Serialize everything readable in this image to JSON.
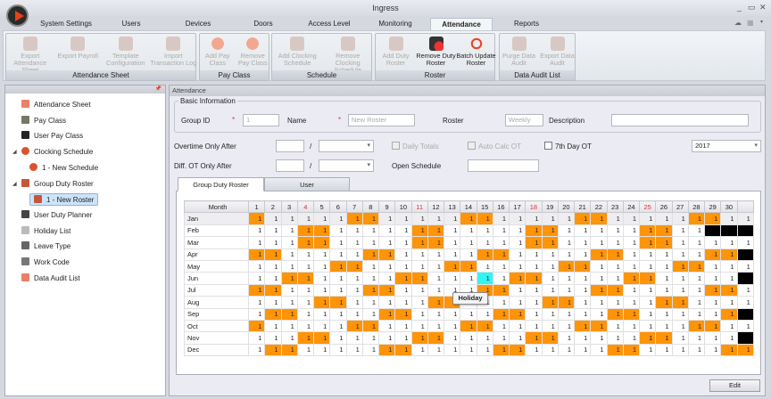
{
  "window": {
    "title": "Ingress",
    "controls": [
      "_",
      "▭",
      "✕"
    ]
  },
  "menu_tabs": [
    "System Settings",
    "Users",
    "Devices",
    "Doors",
    "Access Level",
    "Monitoring",
    "Attendance",
    "Reports"
  ],
  "active_tab": "Attendance",
  "ribbon": {
    "groups": [
      {
        "label": "Attendance Sheet",
        "buttons": [
          {
            "label": "Export Attendance Sheet",
            "enabled": false
          },
          {
            "label": "Export Payroll",
            "enabled": false
          },
          {
            "label": "Template Configuration",
            "enabled": false
          },
          {
            "label": "Import Transaction Log",
            "enabled": false
          }
        ]
      },
      {
        "label": "Pay Class",
        "buttons": [
          {
            "label": "Add Pay Class",
            "enabled": false
          },
          {
            "label": "Remove Pay Class",
            "enabled": false
          }
        ]
      },
      {
        "label": "Schedule",
        "buttons": [
          {
            "label": "Add Clocking Schedule",
            "enabled": false
          },
          {
            "label": "Remove Clocking Schedule",
            "enabled": false
          }
        ]
      },
      {
        "label": "Roster",
        "buttons": [
          {
            "label": "Add Duty Roster",
            "enabled": false
          },
          {
            "label": "Remove Duty Roster",
            "enabled": true
          },
          {
            "label": "Batch Update Roster",
            "enabled": true
          }
        ]
      },
      {
        "label": "Data Audit List",
        "buttons": [
          {
            "label": "Purge Data Audit",
            "enabled": false
          },
          {
            "label": "Export Data Audit",
            "enabled": false
          }
        ]
      }
    ]
  },
  "sidebar": {
    "items": [
      {
        "label": "Attendance Sheet",
        "icon": "attendance-sheet-icon"
      },
      {
        "label": "Pay Class",
        "icon": "money-bag-icon"
      },
      {
        "label": "User Pay Class",
        "icon": "user-icon"
      },
      {
        "label": "Clocking Schedule",
        "icon": "clock-icon"
      },
      {
        "label": "1 - New Schedule",
        "icon": "clock-icon"
      },
      {
        "label": "Group Duty Roster",
        "icon": "calendar-icon"
      },
      {
        "label": "1 - New Roster",
        "icon": "calendar-icon"
      },
      {
        "label": "User Duty Planner",
        "icon": "briefcase-icon"
      },
      {
        "label": "Holiday List",
        "icon": "sandals-icon"
      },
      {
        "label": "Leave Type",
        "icon": "leave-icon"
      },
      {
        "label": "Work Code",
        "icon": "chat-icon"
      },
      {
        "label": "Data Audit List",
        "icon": "list-icon"
      }
    ]
  },
  "panel_title": "Attendance",
  "basic_info": {
    "legend": "Basic Information",
    "group_id_label": "Group ID",
    "group_id_value": "1",
    "name_label": "Name",
    "name_placeholder": "New Roster",
    "roster_label": "Roster",
    "roster_value": "Weekly",
    "description_label": "Description",
    "description_value": "",
    "required_mark": "*"
  },
  "overtime": {
    "label": "Overtime Only After",
    "separator": "/",
    "daily_totals": "Daily Totals",
    "auto_calc_ot": "Auto Calc OT",
    "seventh_day_ot": "7th Day OT",
    "year": "2017"
  },
  "diff_ot": {
    "label": "Diff. OT Only After",
    "separator": "/",
    "open_schedule": "Open Schedule"
  },
  "roster_tabs": [
    "Group Duty Roster",
    "User"
  ],
  "grid": {
    "month_header": "Month",
    "day_headers": [
      "1",
      "2",
      "3",
      "4",
      "5",
      "6",
      "7",
      "8",
      "9",
      "10",
      "11",
      "12",
      "13",
      "14",
      "15",
      "16",
      "17",
      "18",
      "19",
      "20",
      "21",
      "22",
      "23",
      "24",
      "25",
      "26",
      "27",
      "28",
      "29",
      "30",
      ""
    ],
    "red_days": [
      "4",
      "11",
      "18",
      "25"
    ],
    "cell_value": "1",
    "colors": {
      "weekend": "#ff9406",
      "invalid": "#000000",
      "holiday": "#30f5f2"
    },
    "rows": [
      {
        "month": "Jan",
        "status": "W.....WW.....WW.....WW.....WW.."
      },
      {
        "month": "Feb",
        "status": "...WW.....WW.....WW.....WW..XXX"
      },
      {
        "month": "Mar",
        "status": "...WW.....WW.....WW.....WW....."
      },
      {
        "month": "Apr",
        "status": "WW.....WW.....WW.....WW.....WWX"
      },
      {
        "month": "May",
        "status": ".....WW.....WW.....WW.....WW..."
      },
      {
        "month": "Jun",
        "status": "..WW.....WW...H.WW.....WW.....X"
      },
      {
        "month": "Jul",
        "status": "WW.....WW.....WW.....WW.....WW."
      },
      {
        "month": "Aug",
        "status": "....WW.....WW.....WW.....WW...."
      },
      {
        "month": "Sep",
        "status": ".WW.....WW.....WW.....WW.....WX"
      },
      {
        "month": "Oct",
        "status": "W.....WW.....WW.....WW.....WW.."
      },
      {
        "month": "Nov",
        "status": "...WW.....WW.....WW.....WW....X"
      },
      {
        "month": "Dec",
        "status": ".WW.....WW.....WW.....WW.....WW"
      }
    ]
  },
  "tooltip": "Holiday",
  "edit_button": "Edit"
}
